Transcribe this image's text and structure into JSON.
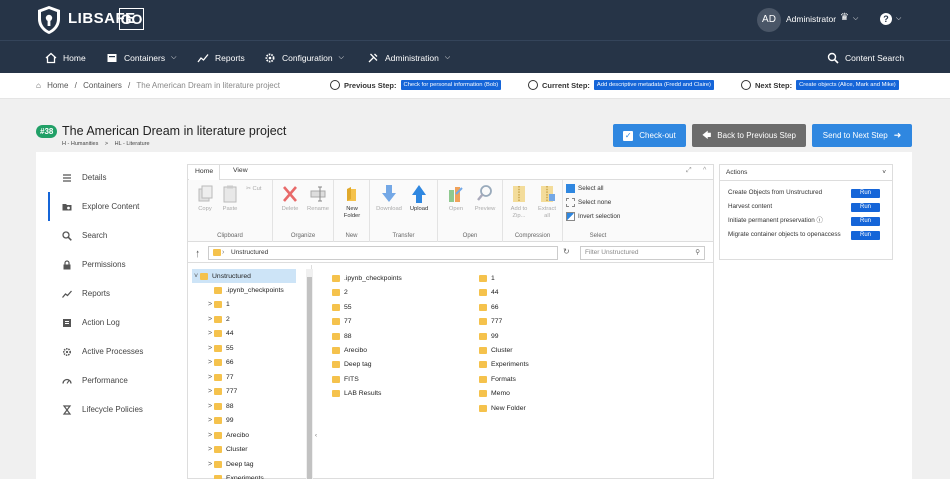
{
  "header": {
    "brand": "LIBSAFE",
    "brand_suffix": "GO",
    "avatar_initials": "AD",
    "user_name": "Administrator",
    "help_glyph": "?"
  },
  "nav": [
    {
      "label": "Home",
      "icon": "home-icon",
      "has_menu": false
    },
    {
      "label": "Containers",
      "icon": "containers-icon",
      "has_menu": true
    },
    {
      "label": "Reports",
      "icon": "reports-icon",
      "has_menu": false
    },
    {
      "label": "Configuration",
      "icon": "gear-icon",
      "has_menu": true
    },
    {
      "label": "Administration",
      "icon": "tools-icon",
      "has_menu": true
    }
  ],
  "content_search": "Content Search",
  "breadcrumb": {
    "home": "Home",
    "sep": "/",
    "containers": "Containers",
    "current": "The American Dream in literature project"
  },
  "steps": {
    "previous_label": "Previous Step:",
    "previous_value": "Check for personal information (Bob)",
    "current_label": "Current Step:",
    "current_value": "Add descriptive metadata (Fredd and Claire)",
    "next_label": "Next Step:",
    "next_value": "Create objects (Alice, Mark and Mike)"
  },
  "project": {
    "badge": "#38",
    "title": "The American Dream in literature project",
    "subcrumb_a": "H - Humanities",
    "subcrumb_sep": ">",
    "subcrumb_b": "HL - Literature"
  },
  "buttons": {
    "checkout": "Check-out",
    "back": "Back to Previous Step",
    "send": "Send to Next Step"
  },
  "sidebar": [
    {
      "label": "Details",
      "icon": "list-icon",
      "active": false
    },
    {
      "label": "Explore Content",
      "icon": "folder-search-icon",
      "active": true
    },
    {
      "label": "Search",
      "icon": "search-icon",
      "active": false
    },
    {
      "label": "Permissions",
      "icon": "lock-icon",
      "active": false
    },
    {
      "label": "Reports",
      "icon": "reports-icon",
      "active": false
    },
    {
      "label": "Action Log",
      "icon": "log-icon",
      "active": false
    },
    {
      "label": "Active Processes",
      "icon": "gear-icon",
      "active": false
    },
    {
      "label": "Performance",
      "icon": "gauge-icon",
      "active": false
    },
    {
      "label": "Lifecycle Policies",
      "icon": "hourglass-icon",
      "active": false
    }
  ],
  "explorer": {
    "tabs": [
      "Home",
      "View"
    ],
    "groups": {
      "clipboard": "Clipboard",
      "organize": "Organize",
      "new": "New",
      "transfer": "Transfer",
      "open": "Open",
      "compression": "Compression",
      "select": "Select"
    },
    "ribbon": {
      "copy": "Copy",
      "paste": "Paste",
      "cut": "Cut",
      "delete": "Delete",
      "rename": "Rename",
      "new_folder_1": "New",
      "new_folder_2": "Folder",
      "download": "Download",
      "upload": "Upload",
      "open": "Open",
      "preview": "Preview",
      "add_to_1": "Add to",
      "add_to_2": "Zip...",
      "extract_1": "Extract",
      "extract_2": "all",
      "select_all": "Select all",
      "select_none": "Select none",
      "invert": "Invert selection"
    },
    "path": "Unstructured",
    "filter_placeholder": "Filter Unstructured",
    "tree_root": "Unstructured",
    "tree": [
      ".ipynb_checkpoints",
      "1",
      "2",
      "44",
      "55",
      "66",
      "77",
      "777",
      "88",
      "99",
      "Arecibo",
      "Cluster",
      "Deep tag",
      "Experiments"
    ],
    "files_left": [
      ".ipynb_checkpoints",
      "2",
      "55",
      "77",
      "88",
      "Arecibo",
      "Deep tag",
      "FITS",
      "LAB Results"
    ],
    "files_right": [
      "1",
      "44",
      "66",
      "777",
      "99",
      "Cluster",
      "Experiments",
      "Formats",
      "Memo",
      "New Folder"
    ]
  },
  "actions": {
    "title": "Actions",
    "run_label": "Run",
    "rows": [
      {
        "label": "Create Objects from Unstructured"
      },
      {
        "label": "Harvest content"
      },
      {
        "label": "Initiate permanent preservation"
      },
      {
        "label": "Migrate container objects to openaccess"
      }
    ]
  },
  "colors": {
    "navy": "#263447",
    "accent": "#1565d8",
    "badge": "#21a067",
    "folder": "#f5c24c"
  }
}
